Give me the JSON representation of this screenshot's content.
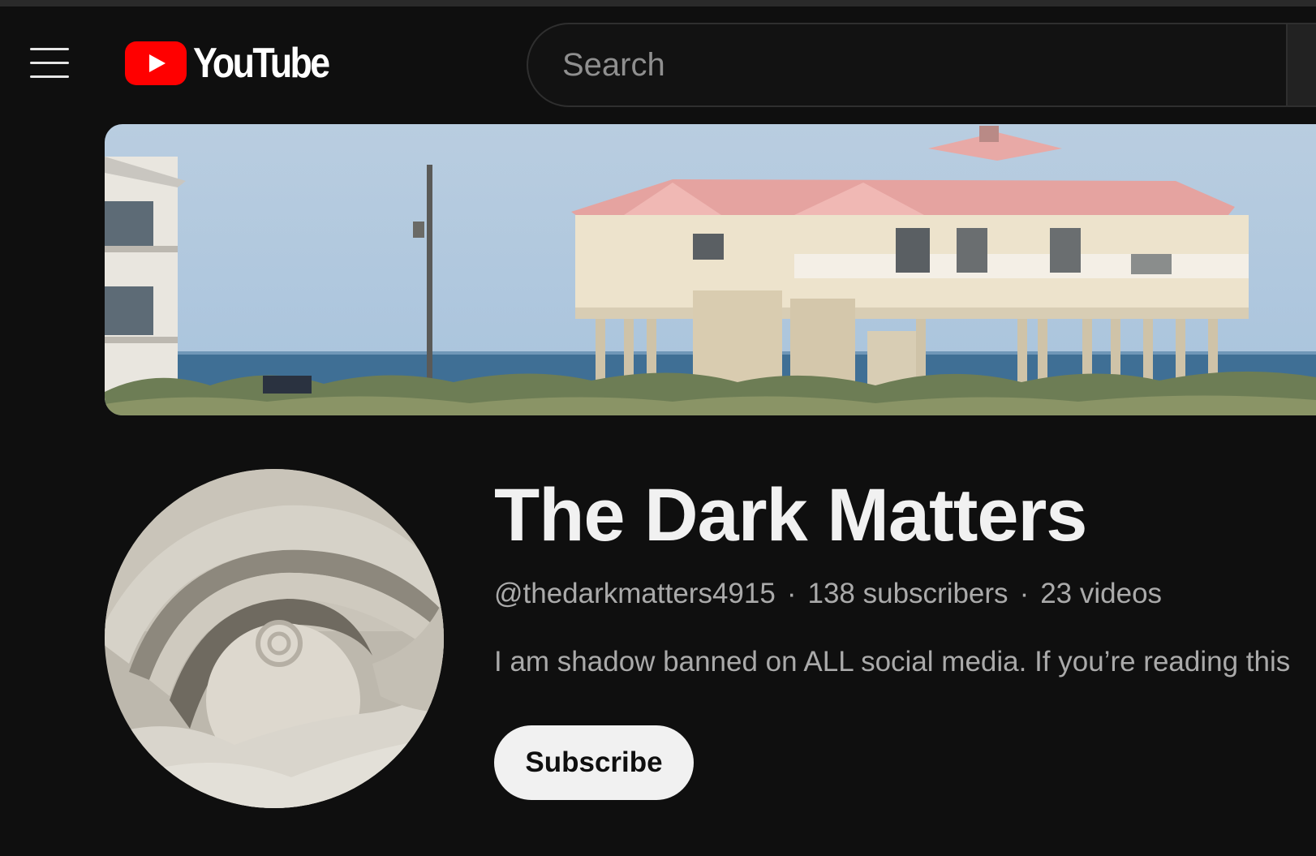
{
  "header": {
    "logo_text": "YouTube",
    "search_placeholder": "Search"
  },
  "channel": {
    "name": "The Dark Matters",
    "handle": "@thedarkmatters4915",
    "separator": "·",
    "subscribers": "138 subscribers",
    "videos": "23 videos",
    "description": "I am shadow banned on ALL social media. If you’re reading this",
    "subscribe_label": "Subscribe"
  },
  "icons": {
    "menu": "hamburger-menu-icon",
    "logo": "youtube-play-icon"
  },
  "colors": {
    "background": "#0f0f0f",
    "logo_red": "#ff0000",
    "subscribe_bg": "#f1f1f1",
    "secondary_text": "#aaaaaa"
  }
}
